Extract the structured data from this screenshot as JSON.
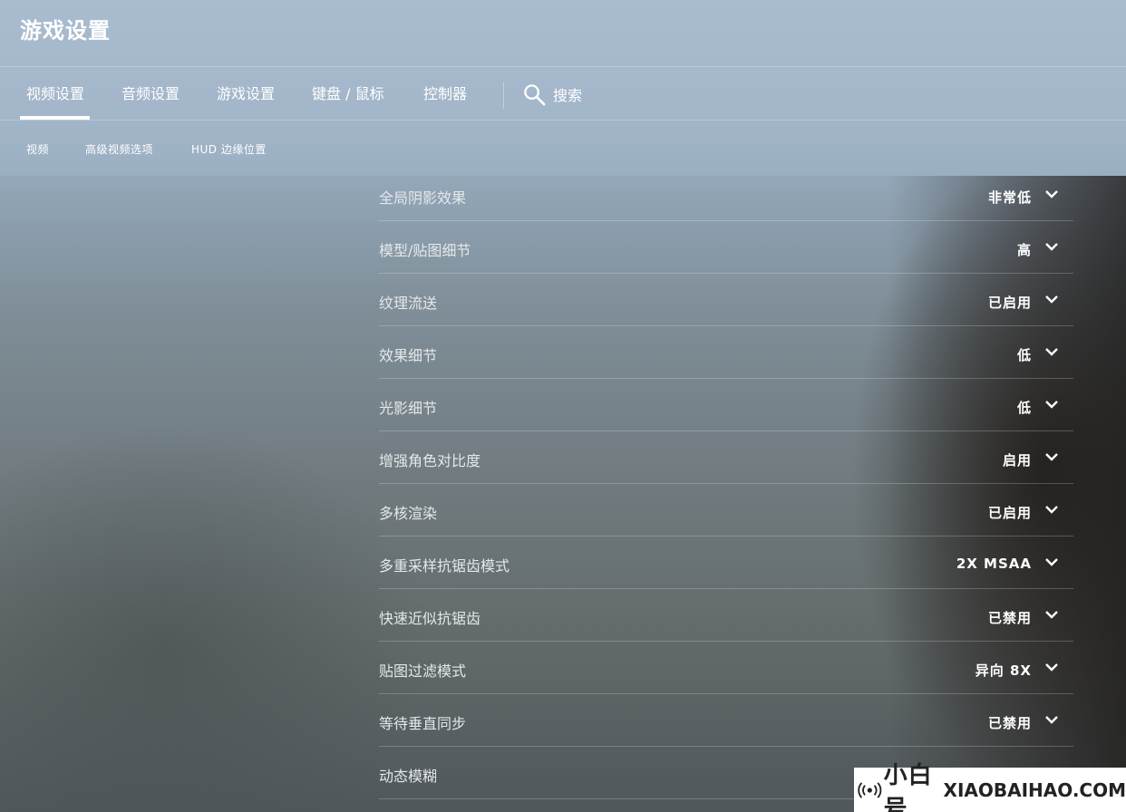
{
  "app_title": "游戏设置",
  "tabs": [
    {
      "label": "视频设置",
      "active": true
    },
    {
      "label": "音频设置",
      "active": false
    },
    {
      "label": "游戏设置",
      "active": false
    },
    {
      "label": "键盘 / 鼠标",
      "active": false
    },
    {
      "label": "控制器",
      "active": false
    }
  ],
  "search": {
    "label": "搜索",
    "icon": "search-icon"
  },
  "subtabs": [
    {
      "label": "视频"
    },
    {
      "label": "高级视频选项"
    },
    {
      "label": "HUD 边缘位置"
    }
  ],
  "settings": [
    {
      "label": "全局阴影效果",
      "value": "非常低"
    },
    {
      "label": "模型/贴图细节",
      "value": "高"
    },
    {
      "label": "纹理流送",
      "value": "已启用"
    },
    {
      "label": "效果细节",
      "value": "低"
    },
    {
      "label": "光影细节",
      "value": "低"
    },
    {
      "label": "增强角色对比度",
      "value": "启用"
    },
    {
      "label": "多核渲染",
      "value": "已启用"
    },
    {
      "label": "多重采样抗锯齿模式",
      "value": "2X MSAA"
    },
    {
      "label": "快速近似抗锯齿",
      "value": "已禁用"
    },
    {
      "label": "贴图过滤模式",
      "value": "异向 8X"
    },
    {
      "label": "等待垂直同步",
      "value": "已禁用"
    },
    {
      "label": "动态模糊",
      "value": ""
    }
  ],
  "watermark": {
    "cn": "小白号",
    "en": "XIAOBAIHAO.COM"
  },
  "colors": {
    "accent": "#ffffff",
    "header_bg": "#a3b6ca",
    "divider": "rgba(255,255,255,0.22)"
  }
}
